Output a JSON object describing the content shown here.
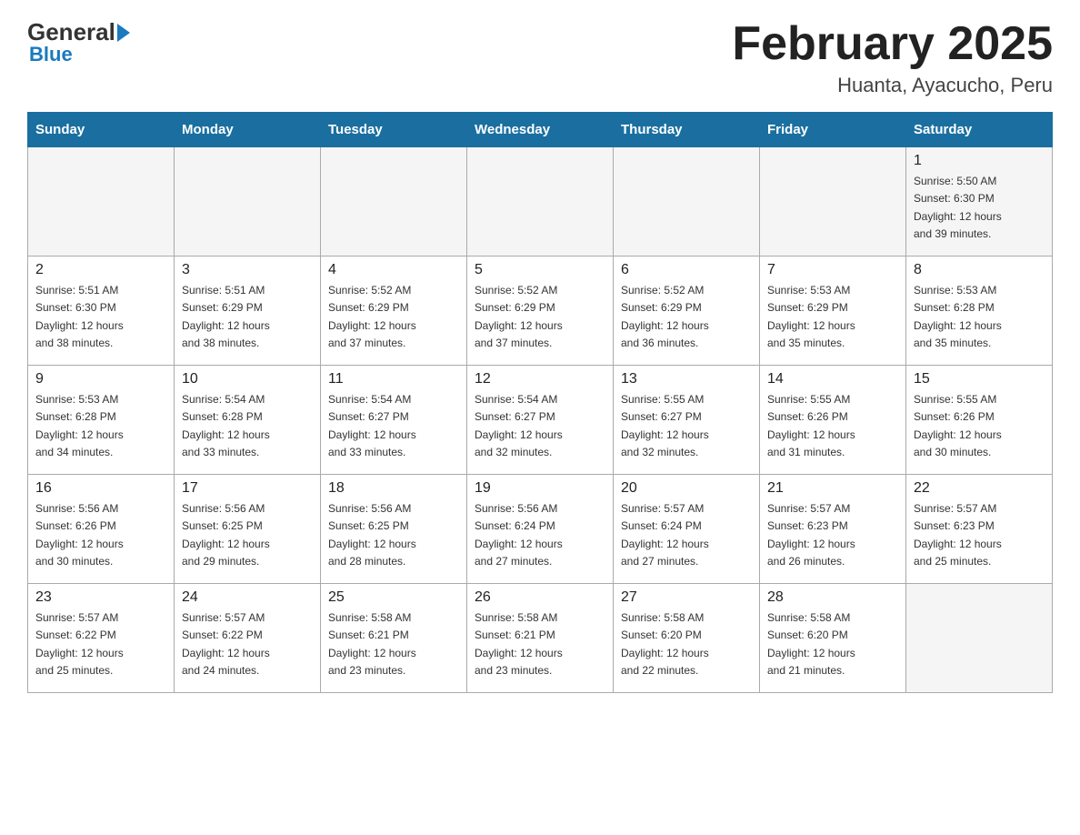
{
  "header": {
    "logo_general": "General",
    "logo_blue": "Blue",
    "title": "February 2025",
    "subtitle": "Huanta, Ayacucho, Peru"
  },
  "days_of_week": [
    "Sunday",
    "Monday",
    "Tuesday",
    "Wednesday",
    "Thursday",
    "Friday",
    "Saturday"
  ],
  "weeks": [
    [
      {
        "day": "",
        "info": ""
      },
      {
        "day": "",
        "info": ""
      },
      {
        "day": "",
        "info": ""
      },
      {
        "day": "",
        "info": ""
      },
      {
        "day": "",
        "info": ""
      },
      {
        "day": "",
        "info": ""
      },
      {
        "day": "1",
        "info": "Sunrise: 5:50 AM\nSunset: 6:30 PM\nDaylight: 12 hours\nand 39 minutes."
      }
    ],
    [
      {
        "day": "2",
        "info": "Sunrise: 5:51 AM\nSunset: 6:30 PM\nDaylight: 12 hours\nand 38 minutes."
      },
      {
        "day": "3",
        "info": "Sunrise: 5:51 AM\nSunset: 6:29 PM\nDaylight: 12 hours\nand 38 minutes."
      },
      {
        "day": "4",
        "info": "Sunrise: 5:52 AM\nSunset: 6:29 PM\nDaylight: 12 hours\nand 37 minutes."
      },
      {
        "day": "5",
        "info": "Sunrise: 5:52 AM\nSunset: 6:29 PM\nDaylight: 12 hours\nand 37 minutes."
      },
      {
        "day": "6",
        "info": "Sunrise: 5:52 AM\nSunset: 6:29 PM\nDaylight: 12 hours\nand 36 minutes."
      },
      {
        "day": "7",
        "info": "Sunrise: 5:53 AM\nSunset: 6:29 PM\nDaylight: 12 hours\nand 35 minutes."
      },
      {
        "day": "8",
        "info": "Sunrise: 5:53 AM\nSunset: 6:28 PM\nDaylight: 12 hours\nand 35 minutes."
      }
    ],
    [
      {
        "day": "9",
        "info": "Sunrise: 5:53 AM\nSunset: 6:28 PM\nDaylight: 12 hours\nand 34 minutes."
      },
      {
        "day": "10",
        "info": "Sunrise: 5:54 AM\nSunset: 6:28 PM\nDaylight: 12 hours\nand 33 minutes."
      },
      {
        "day": "11",
        "info": "Sunrise: 5:54 AM\nSunset: 6:27 PM\nDaylight: 12 hours\nand 33 minutes."
      },
      {
        "day": "12",
        "info": "Sunrise: 5:54 AM\nSunset: 6:27 PM\nDaylight: 12 hours\nand 32 minutes."
      },
      {
        "day": "13",
        "info": "Sunrise: 5:55 AM\nSunset: 6:27 PM\nDaylight: 12 hours\nand 32 minutes."
      },
      {
        "day": "14",
        "info": "Sunrise: 5:55 AM\nSunset: 6:26 PM\nDaylight: 12 hours\nand 31 minutes."
      },
      {
        "day": "15",
        "info": "Sunrise: 5:55 AM\nSunset: 6:26 PM\nDaylight: 12 hours\nand 30 minutes."
      }
    ],
    [
      {
        "day": "16",
        "info": "Sunrise: 5:56 AM\nSunset: 6:26 PM\nDaylight: 12 hours\nand 30 minutes."
      },
      {
        "day": "17",
        "info": "Sunrise: 5:56 AM\nSunset: 6:25 PM\nDaylight: 12 hours\nand 29 minutes."
      },
      {
        "day": "18",
        "info": "Sunrise: 5:56 AM\nSunset: 6:25 PM\nDaylight: 12 hours\nand 28 minutes."
      },
      {
        "day": "19",
        "info": "Sunrise: 5:56 AM\nSunset: 6:24 PM\nDaylight: 12 hours\nand 27 minutes."
      },
      {
        "day": "20",
        "info": "Sunrise: 5:57 AM\nSunset: 6:24 PM\nDaylight: 12 hours\nand 27 minutes."
      },
      {
        "day": "21",
        "info": "Sunrise: 5:57 AM\nSunset: 6:23 PM\nDaylight: 12 hours\nand 26 minutes."
      },
      {
        "day": "22",
        "info": "Sunrise: 5:57 AM\nSunset: 6:23 PM\nDaylight: 12 hours\nand 25 minutes."
      }
    ],
    [
      {
        "day": "23",
        "info": "Sunrise: 5:57 AM\nSunset: 6:22 PM\nDaylight: 12 hours\nand 25 minutes."
      },
      {
        "day": "24",
        "info": "Sunrise: 5:57 AM\nSunset: 6:22 PM\nDaylight: 12 hours\nand 24 minutes."
      },
      {
        "day": "25",
        "info": "Sunrise: 5:58 AM\nSunset: 6:21 PM\nDaylight: 12 hours\nand 23 minutes."
      },
      {
        "day": "26",
        "info": "Sunrise: 5:58 AM\nSunset: 6:21 PM\nDaylight: 12 hours\nand 23 minutes."
      },
      {
        "day": "27",
        "info": "Sunrise: 5:58 AM\nSunset: 6:20 PM\nDaylight: 12 hours\nand 22 minutes."
      },
      {
        "day": "28",
        "info": "Sunrise: 5:58 AM\nSunset: 6:20 PM\nDaylight: 12 hours\nand 21 minutes."
      },
      {
        "day": "",
        "info": ""
      }
    ]
  ]
}
